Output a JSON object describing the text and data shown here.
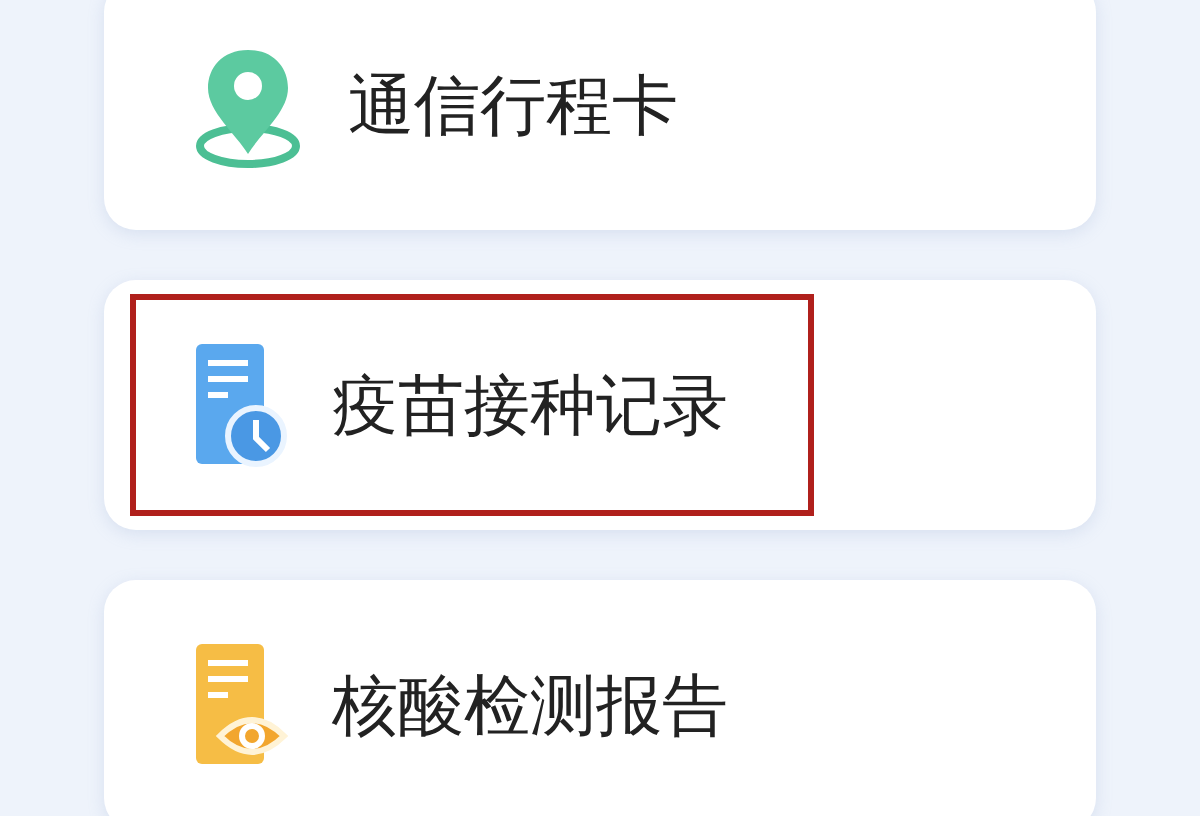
{
  "items": [
    {
      "label": "通信行程卡",
      "kind": "pin",
      "highlighted": false
    },
    {
      "label": "疫苗接种记录",
      "kind": "doc-clock",
      "highlighted": true
    },
    {
      "label": "核酸检测报告",
      "kind": "doc-eye",
      "highlighted": false
    }
  ]
}
